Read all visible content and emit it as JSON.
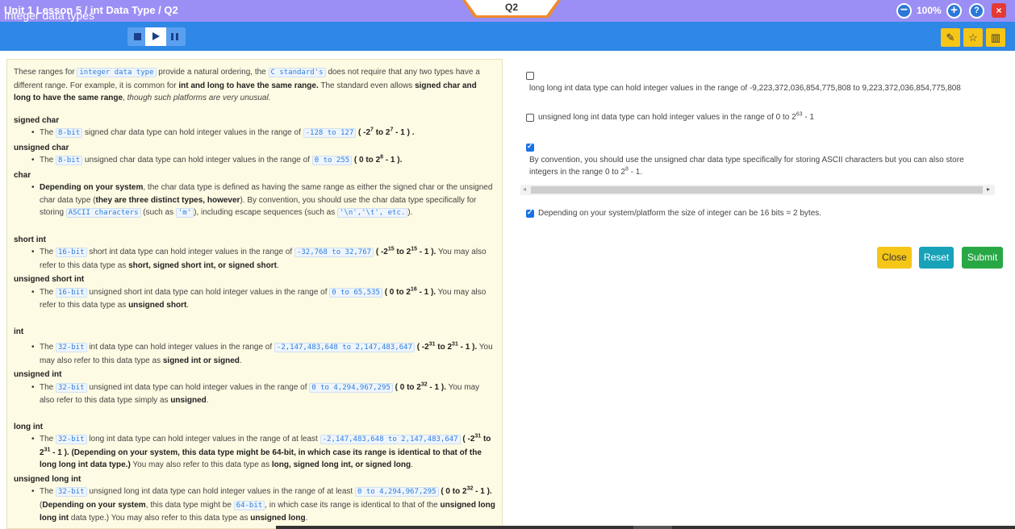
{
  "topbar": {
    "breadcrumb": "Unit 1 Lesson 5 / int Data Type / Q2",
    "center_tab": "Q2",
    "zoom": "100%",
    "zoom_minus": "−",
    "zoom_plus": "+",
    "help": "?",
    "close": "×"
  },
  "lesson": {
    "title": "Integer data types"
  },
  "icons": {
    "stop": "stop-icon",
    "play": "play-icon",
    "pause": "pause-icon",
    "pencil": "✎",
    "star": "☆",
    "chart": "▥"
  },
  "content": {
    "intro_1": "These ranges for",
    "intro_code1": "integer data type",
    "intro_2": "provide a natural ordering, the",
    "intro_code2": "C standard's",
    "intro_3": "does not require that any two types have a different range. For example, it is common for",
    "intro_bold1": "int and long to have the same range.",
    "intro_4": "The standard even allows",
    "intro_bold2": "signed char and long to have the same range",
    "intro_5": ",",
    "intro_ital": "though such platforms are very unusual.",
    "signed_char_title": "signed char",
    "sc_1": "The",
    "sc_code1": "8-bit",
    "sc_2": "signed char data type can hold integer values in the range of",
    "sc_code2": "-128 to 127",
    "sc_3": "( -2",
    "sc_sup1": "7",
    "sc_4": " to 2",
    "sc_sup2": "7",
    "sc_5": " - 1 ) .",
    "unsigned_char_title": "unsigned char",
    "uc_1": "The",
    "uc_code1": "8-bit",
    "uc_2": "unsigned char data type can hold integer values in the range of",
    "uc_code2": "0 to 255",
    "uc_3": "( 0 to 2",
    "uc_sup": "8",
    "uc_4": " - 1 ).",
    "char_title": "char",
    "ch_bold1": "Depending on your system",
    "ch_1": ", the char data type is defined as having the same range as either the signed char or the unsigned char data type (",
    "ch_bold2": "they are three distinct types, however",
    "ch_2": "). By convention, you should use the char data type specifically for storing",
    "ch_code1": "ASCII characters",
    "ch_3": "(such as",
    "ch_code2": "'m'",
    "ch_4": "), including escape sequences (such as",
    "ch_code3": "'\\n','\\t', etc.",
    "ch_5": ").",
    "short_int_title": "short int",
    "si_1": "The",
    "si_code1": "16-bit",
    "si_2": "short int data type can hold integer values in the range of",
    "si_code2": "-32,768 to 32,767",
    "si_3": "( -2",
    "si_sup1": "15",
    "si_4": " to 2",
    "si_sup2": "15",
    "si_5": " - 1 ).",
    "si_6": "You may also refer to this data type as",
    "si_bold": "short, signed short int, or signed short",
    "si_7": ".",
    "unsigned_short_title": "unsigned short int",
    "us_1": "The",
    "us_code1": "16-bit",
    "us_2": "unsigned short int data type can hold integer values in the range of",
    "us_code2": "0 to 65,535",
    "us_3": "( 0 to 2",
    "us_sup": "16",
    "us_4": " - 1 ).",
    "us_5": "You may also refer to this data type as",
    "us_bold": "unsigned short",
    "us_6": ".",
    "int_title": "int",
    "in_1": "The",
    "in_code1": "32-bit",
    "in_2": "int data type can hold integer values in the range of",
    "in_code2": "-2,147,483,648 to 2,147,483,647",
    "in_3": "( -2",
    "in_sup1": "31",
    "in_4": " to 2",
    "in_sup2": "31",
    "in_5": " - 1 ).",
    "in_6": "You may also refer to this data type as",
    "in_bold": "signed int or signed",
    "in_7": ".",
    "unsigned_int_title": "unsigned int",
    "ui_1": "The",
    "ui_code1": "32-bit",
    "ui_2": "unsigned int data type can hold integer values in the range of",
    "ui_code2": "0 to 4,294,967,295",
    "ui_3": "( 0 to 2",
    "ui_sup": "32",
    "ui_4": " - 1 ).",
    "ui_5": "You may also refer to this data type simply as",
    "ui_bold": "unsigned",
    "ui_6": ".",
    "long_int_title": "long int",
    "li_1": "The",
    "li_code1": "32-bit",
    "li_2": "long int data type can hold integer values in the range of at least",
    "li_code2": "-2,147,483,648 to 2,147,483,647",
    "li_3": "( -2",
    "li_sup1": "31",
    "li_4": " to 2",
    "li_sup2": "31",
    "li_5": " - 1 ). (Depending on your system, this data type might be 64-bit, in which case its range is identical to that of the long long int data type.)",
    "li_6": "You may also refer to this data type as",
    "li_bold": "long, signed long int, or signed long",
    "li_7": ".",
    "unsigned_long_title": "unsigned long int",
    "ul_1": "The",
    "ul_code1": "32-bit",
    "ul_2": "unsigned long int data type can hold integer values in the range of at least",
    "ul_code2": "0 to 4,294,967,295",
    "ul_3": "( 0 to 2",
    "ul_sup": "32",
    "ul_4": " - 1 ).",
    "ul_5": "(",
    "ul_bold1": "Depending on your system",
    "ul_6": ", this data type might be",
    "ul_code3": "64-bit",
    "ul_7": ", in which case its range is identical to that of the",
    "ul_bold2": "unsigned long long int",
    "ul_8": "data type.) You may also refer to this data type as",
    "ul_bold3": "unsigned long",
    "ul_9": "."
  },
  "options": [
    {
      "checked": false,
      "text": "long long int data type can hold integer values in the range of -9,223,372,036,854,775,808 to 9,223,372,036,854,775,808"
    },
    {
      "checked": false,
      "text_1": "unsigned long int data type can hold integer values in the range of 0 to 2",
      "sup": "63",
      "text_2": " - 1"
    },
    {
      "checked": true,
      "text_1": "By convention, you should use the unsigned char data type specifically for storing ASCII characters but you can also store integers in the range 0 to 2",
      "sup": "8",
      "text_2": " - 1."
    },
    {
      "checked": true,
      "text": "Depending on your system/platform the size of integer can be 16 bits = 2 bytes."
    }
  ],
  "scroll": {
    "left": "◂",
    "right": "▸"
  },
  "actions": {
    "close": "Close",
    "reset": "Reset",
    "submit": "Submit"
  }
}
